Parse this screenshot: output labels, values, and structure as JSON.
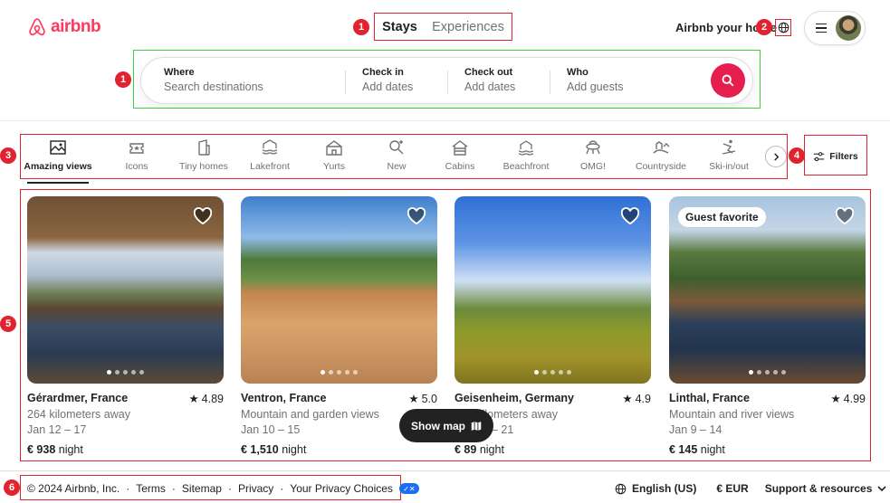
{
  "brand": {
    "name": "airbnb",
    "color": "#FF385C"
  },
  "nav": {
    "tabs": [
      {
        "label": "Stays",
        "active": true
      },
      {
        "label": "Experiences",
        "active": false
      }
    ]
  },
  "header": {
    "host_link": "Airbnb your home",
    "globe_icon": "globe-icon",
    "menu_icon": "hamburger-icon"
  },
  "search": {
    "where": {
      "label": "Where",
      "placeholder": "Search destinations"
    },
    "checkin": {
      "label": "Check in",
      "placeholder": "Add dates"
    },
    "checkout": {
      "label": "Check out",
      "placeholder": "Add dates"
    },
    "who": {
      "label": "Who",
      "placeholder": "Add guests"
    },
    "button_icon": "search-icon",
    "button_color": "#E61E4D"
  },
  "categories": [
    {
      "label": "Amazing views",
      "icon": "amazing-views-icon",
      "active": true
    },
    {
      "label": "Icons",
      "icon": "icons-icon"
    },
    {
      "label": "Tiny homes",
      "icon": "tiny-homes-icon"
    },
    {
      "label": "Lakefront",
      "icon": "lakefront-icon"
    },
    {
      "label": "Yurts",
      "icon": "yurts-icon"
    },
    {
      "label": "New",
      "icon": "new-icon"
    },
    {
      "label": "Cabins",
      "icon": "cabins-icon"
    },
    {
      "label": "Beachfront",
      "icon": "beachfront-icon"
    },
    {
      "label": "OMG!",
      "icon": "omg-icon"
    },
    {
      "label": "Countryside",
      "icon": "countryside-icon"
    },
    {
      "label": "Ski-in/out",
      "icon": "ski-icon"
    }
  ],
  "filters": {
    "label": "Filters"
  },
  "listings": [
    {
      "location": "Gérardmer, France",
      "rating": "4.89",
      "line1": "264 kilometers away",
      "line2": "Jan 12 – 17",
      "price": "€ 938",
      "price_suffix": " night",
      "badge": ""
    },
    {
      "location": "Ventron, France",
      "rating": "5.0",
      "line1": "Mountain and garden views",
      "line2": "Jan 10 – 15",
      "price": "€ 1,510",
      "price_suffix": " night",
      "badge": ""
    },
    {
      "location": "Geisenheim, Germany",
      "rating": "4.9",
      "line1": "290 kilometers away",
      "line2": "Jan 16 – 21",
      "price": "€ 89",
      "price_suffix": " night",
      "badge": ""
    },
    {
      "location": "Linthal, France",
      "rating": "4.99",
      "line1": "Mountain and river views",
      "line2": "Jan 9 – 14",
      "price": "€ 145",
      "price_suffix": " night",
      "badge": "Guest favorite"
    }
  ],
  "show_map": {
    "label": "Show map"
  },
  "footer": {
    "copyright": "© 2024 Airbnb, Inc.",
    "links": [
      "Terms",
      "Sitemap",
      "Privacy",
      "Your Privacy Choices"
    ],
    "language": "English (US)",
    "currency": "€ EUR",
    "support": "Support & resources"
  },
  "annotations": [
    "1",
    "2",
    "1",
    "3",
    "4",
    "5",
    "6"
  ]
}
